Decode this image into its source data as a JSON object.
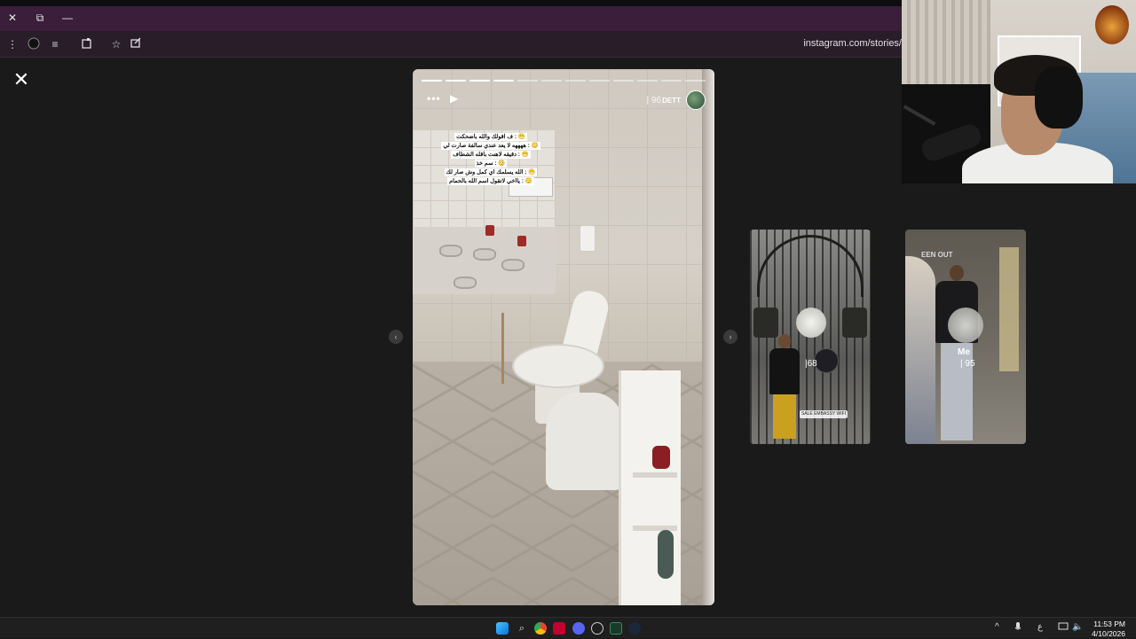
{
  "browser": {
    "window_controls": [
      "✕",
      "⧉",
      "—"
    ],
    "url": "instagram.com/stories/"
  },
  "story": {
    "view_count": "96",
    "username": "DETT",
    "caption_lines": [
      "😁 : ف اقولك والله باضحكت",
      "😳 : ههههه لا يعد عندي سالفة صارت لي",
      "😁 : دقيقه لاهنت باقله الشطاف",
      "😳 : سم خذ",
      "😁 : الله يسلمك اي كمل وش صار لك",
      "😳 : يااخي لاتقول اسم الله بالحمام"
    ],
    "progress_segments": 12,
    "progress_done": 4
  },
  "previews": [
    {
      "count": "68",
      "sticker": "SALE EMBASSY WIFI"
    },
    {
      "label": "Me",
      "count": "95",
      "overlay_text": "EEN OUT"
    }
  ],
  "taskbar": {
    "tray_lang": "ع",
    "time": "11:53 PM",
    "date": "4/10/2026"
  },
  "colors": {
    "titlebar": "#3a1e3a",
    "viewer_bg": "#1a1a1a",
    "taskbar": "#1f1f1f"
  },
  "icons": [
    "close-icon",
    "restore-icon",
    "minimize-icon",
    "menu-icon",
    "profile-icon",
    "media-control-icon",
    "extensions-icon",
    "star-icon",
    "share-icon",
    "more-icon",
    "play-icon",
    "prev-arrow-icon",
    "next-arrow-icon",
    "windows-start-icon",
    "search-icon",
    "chrome-icon",
    "discord-icon",
    "steam-icon",
    "mic-icon",
    "wifi-icon",
    "speaker-icon"
  ]
}
